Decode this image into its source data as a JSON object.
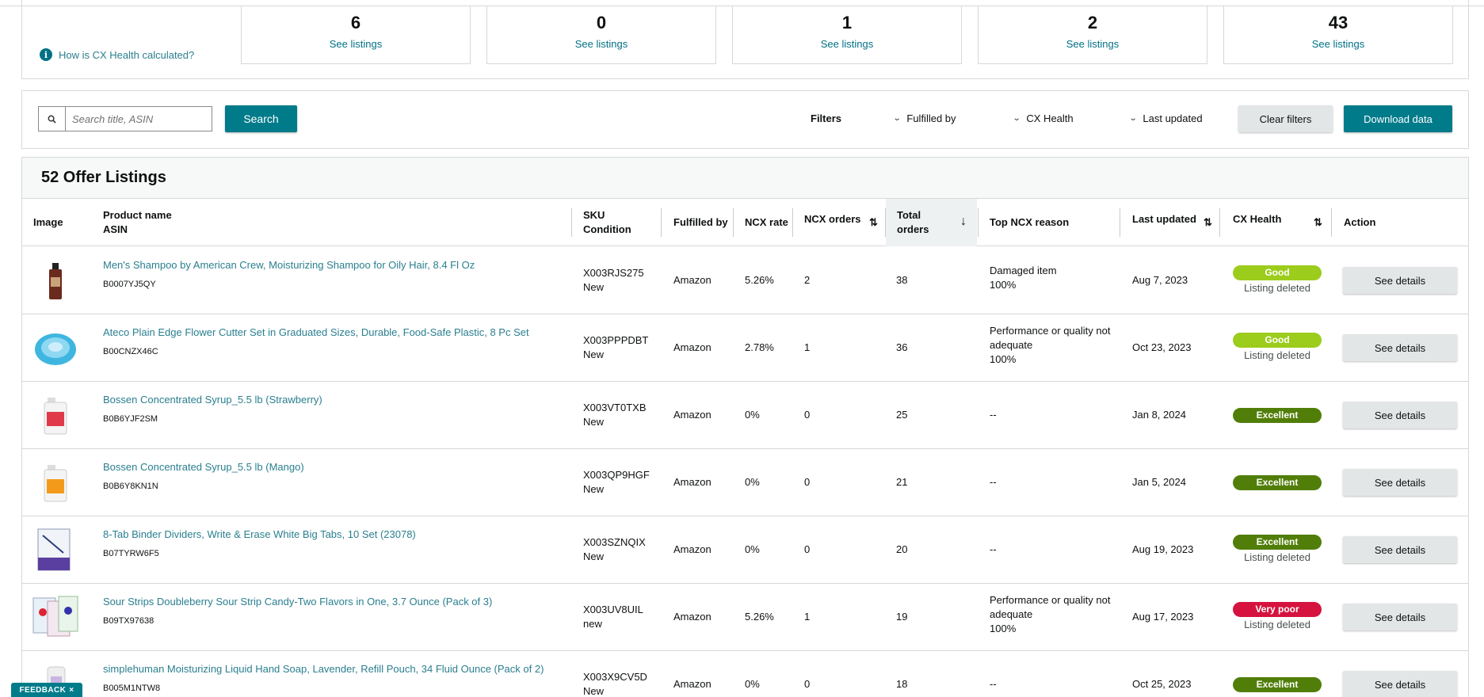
{
  "summary": {
    "cx_calc_link": "How is CX Health calculated?",
    "cards": [
      {
        "count": "6",
        "link": "See listings"
      },
      {
        "count": "0",
        "link": "See listings"
      },
      {
        "count": "1",
        "link": "See listings"
      },
      {
        "count": "2",
        "link": "See listings"
      },
      {
        "count": "43",
        "link": "See listings"
      }
    ]
  },
  "filterbar": {
    "search_placeholder": "Search title, ASIN",
    "search_button": "Search",
    "filters_label": "Filters",
    "dropdowns": [
      "Fulfilled by",
      "CX Health",
      "Last updated"
    ],
    "clear_button": "Clear filters",
    "download_button": "Download data"
  },
  "listings": {
    "title": "52 Offer Listings",
    "columns": {
      "image": "Image",
      "product_name": "Product name",
      "asin": "ASIN",
      "sku": "SKU",
      "condition": "Condition",
      "fulfilled_by": "Fulfilled by",
      "ncx_rate": "NCX rate",
      "ncx_orders": "NCX orders",
      "total_orders_1": "Total",
      "total_orders_2": "orders",
      "top_ncx_reason": "Top NCX reason",
      "last_updated": "Last updated",
      "cx_health": "CX Health",
      "action": "Action"
    },
    "rows": [
      {
        "name": "Men's Shampoo by American Crew, Moisturizing Shampoo for Oily Hair, 8.4 Fl Oz",
        "asin": "B0007YJ5QY",
        "sku": "X003RJS275",
        "condition": "New",
        "fulfilled": "Amazon",
        "ncx_rate": "5.26%",
        "ncx_orders": "2",
        "total": "38",
        "reason_1": "Damaged item",
        "reason_2": "",
        "reason_pct": "100%",
        "updated": "Aug 7, 2023",
        "health": "Good",
        "health_color": "#9ccc1c",
        "status": "Listing deleted",
        "action": "See details",
        "thumb": "shampoo"
      },
      {
        "name": "Ateco Plain Edge Flower Cutter Set in Graduated Sizes, Durable, Food-Safe Plastic, 8 Pc Set",
        "asin": "B00CNZX46C",
        "sku": "X003PPPDBT",
        "condition": "New",
        "fulfilled": "Amazon",
        "ncx_rate": "2.78%",
        "ncx_orders": "1",
        "total": "36",
        "reason_1": "Performance or quality not",
        "reason_2": "adequate",
        "reason_pct": "100%",
        "updated": "Oct 23, 2023",
        "health": "Good",
        "health_color": "#9ccc1c",
        "status": "Listing deleted",
        "action": "See details",
        "thumb": "cutter"
      },
      {
        "name": "Bossen Concentrated Syrup_5.5 lb (Strawberry)",
        "asin": "B0B6YJF2SM",
        "sku": "X003VT0TXB",
        "condition": "New",
        "fulfilled": "Amazon",
        "ncx_rate": "0%",
        "ncx_orders": "0",
        "total": "25",
        "reason_1": "--",
        "reason_2": "",
        "reason_pct": "",
        "updated": "Jan 8, 2024",
        "health": "Excellent",
        "health_color": "#507e09",
        "status": "",
        "action": "See details",
        "thumb": "syrup-red"
      },
      {
        "name": "Bossen Concentrated Syrup_5.5 lb (Mango)",
        "asin": "B0B6Y8KN1N",
        "sku": "X003QP9HGF",
        "condition": "New",
        "fulfilled": "Amazon",
        "ncx_rate": "0%",
        "ncx_orders": "0",
        "total": "21",
        "reason_1": "--",
        "reason_2": "",
        "reason_pct": "",
        "updated": "Jan 5, 2024",
        "health": "Excellent",
        "health_color": "#507e09",
        "status": "",
        "action": "See details",
        "thumb": "syrup-orange"
      },
      {
        "name": "8-Tab Binder Dividers, Write & Erase White Big Tabs, 10 Set (23078)",
        "asin": "B07TYRW6F5",
        "sku": "X003SZNQIX",
        "condition": "New",
        "fulfilled": "Amazon",
        "ncx_rate": "0%",
        "ncx_orders": "0",
        "total": "20",
        "reason_1": "--",
        "reason_2": "",
        "reason_pct": "",
        "updated": "Aug 19, 2023",
        "health": "Excellent",
        "health_color": "#507e09",
        "status": "Listing deleted",
        "action": "See details",
        "thumb": "binder"
      },
      {
        "name": "Sour Strips Doubleberry Sour Strip Candy-Two Flavors in One, 3.7 Ounce (Pack of 3)",
        "asin": "B09TX97638",
        "sku": "X003UV8UIL",
        "condition": "new",
        "fulfilled": "Amazon",
        "ncx_rate": "5.26%",
        "ncx_orders": "1",
        "total": "19",
        "reason_1": "Performance or quality not",
        "reason_2": "adequate",
        "reason_pct": "100%",
        "updated": "Aug 17, 2023",
        "health": "Very poor",
        "health_color": "#d5133e",
        "status": "Listing deleted",
        "action": "See details",
        "thumb": "candy"
      },
      {
        "name": "simplehuman Moisturizing Liquid Hand Soap, Lavender, Refill Pouch, 34 Fluid Ounce (Pack of 2)",
        "asin": "B005M1NTW8",
        "sku": "X003X9CV5D",
        "condition": "New",
        "fulfilled": "Amazon",
        "ncx_rate": "0%",
        "ncx_orders": "0",
        "total": "18",
        "reason_1": "--",
        "reason_2": "",
        "reason_pct": "",
        "updated": "Oct 25, 2023",
        "health": "Excellent",
        "health_color": "#507e09",
        "status": "",
        "action": "See details",
        "thumb": "soap"
      }
    ]
  },
  "feedback": {
    "label": "FEEDBACK",
    "close": "×"
  }
}
